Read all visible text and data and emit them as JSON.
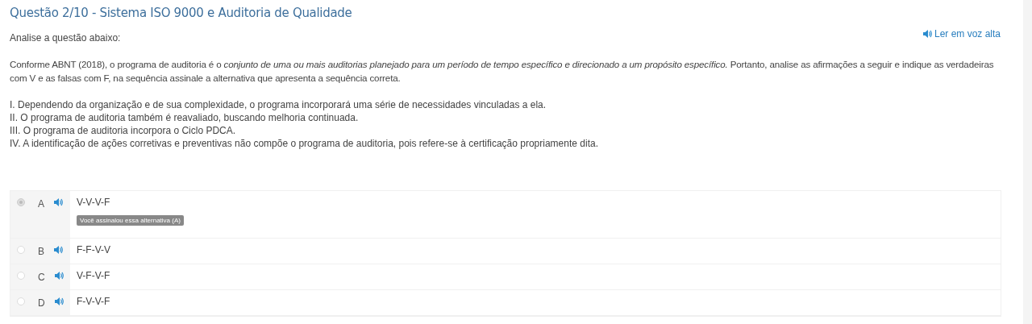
{
  "title": "Questão 2/10 - Sistema ISO 9000 e Auditoria de Qualidade",
  "read_aloud": "Ler em voz alta",
  "intro": "Analise a questão abaixo:",
  "paragraph": "Conforme ABNT (2018), o programa de auditoria é o *conjunto de uma ou mais auditorias planejado para um período de tempo específico e direcionado a um propósito específico.*  Portanto, analise as afirmações a seguir e indique as verdadeiras com V e as falsas com F, na sequência assinale a alternativa que apresenta a sequência correta.",
  "statements": [
    "I. Dependendo da organização e de sua complexidade, o programa incorporará uma série de necessidades vinculadas a ela.",
    "II. O programa de auditoria também é reavaliado, buscando melhoria continuada.",
    "III. O programa de auditoria incorpora o Ciclo PDCA.",
    "IV. A identificação de ações corretivas e preventivas não compõe o programa de auditoria, pois refere-se à certificação propriamente dita."
  ],
  "options": [
    {
      "letter": "A",
      "text": "V-V-V-F",
      "selected": true,
      "note": "Você assinalou essa alternativa (A)"
    },
    {
      "letter": "B",
      "text": "F-F-V-V",
      "selected": false
    },
    {
      "letter": "C",
      "text": "V-F-V-F",
      "selected": false
    },
    {
      "letter": "D",
      "text": "F-V-V-F",
      "selected": false
    }
  ]
}
